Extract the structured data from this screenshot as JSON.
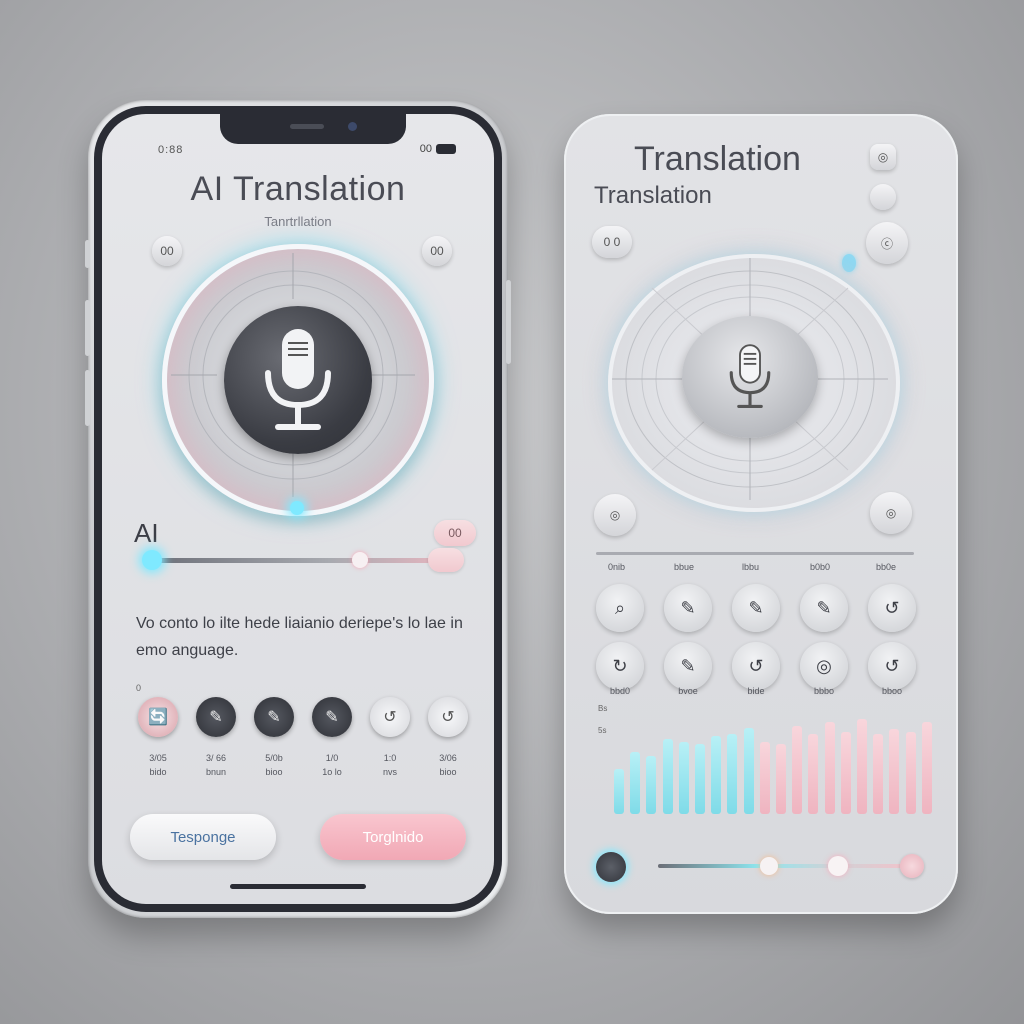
{
  "phone": {
    "status_left": "0:88",
    "status_right": "00",
    "title": "AI Translation",
    "subtitle": "Tanrtrllation",
    "top_left_button": "00",
    "top_right_button": "00",
    "ai_label": "AI",
    "ai_pill": "00",
    "body_text": "Vo conto lo ilte hede liaianio deriepe's lo lae in emo anguage.",
    "dot_marker": "0",
    "languages": [
      {
        "icon": "🔄",
        "caption1": "3/05",
        "caption2": "bido"
      },
      {
        "icon": "✎",
        "caption1": "3/ 66",
        "caption2": "bnun"
      },
      {
        "icon": "✎",
        "caption1": "5/0b",
        "caption2": "bioo"
      },
      {
        "icon": "✎",
        "caption1": "1/0",
        "caption2": "1o lo"
      },
      {
        "icon": "↺",
        "caption1": "1:0",
        "caption2": "nvs"
      },
      {
        "icon": "↺",
        "caption1": "3/06",
        "caption2": "bioo"
      }
    ],
    "left_button_label": "Tesponge",
    "right_button_label": "Torglnido"
  },
  "card": {
    "title_large": "Translation",
    "title_small": "Translation",
    "top_right_icon": "◎",
    "left_button": "0 0",
    "right_button": "ⓒ",
    "mid_left_button": "◎",
    "mid_right_button": "◎",
    "grid_headers": [
      "0nib",
      "bbue",
      "lbbu",
      "b0b0",
      "bb0e"
    ],
    "grid_row1": [
      "⌕",
      "✎",
      "✎",
      "✎",
      "↺"
    ],
    "grid_row2": [
      "↻",
      "✎",
      "↺",
      "◎",
      "↺"
    ],
    "grid_captions": [
      "bbd0",
      "bvoe",
      "bide",
      "bbbo",
      "bboo"
    ],
    "eq_labels": [
      "Bs",
      "5s"
    ],
    "eq_values": [
      0.45,
      0.62,
      0.58,
      0.75,
      0.72,
      0.7,
      0.78,
      0.8,
      0.86,
      0.72,
      0.7,
      0.88,
      0.8,
      0.92,
      0.82,
      0.95,
      0.8,
      0.85,
      0.82,
      0.92
    ]
  },
  "colors": {
    "accent_cyan": "#7fe9ff",
    "accent_pink": "#f4b7c3",
    "dark_core": "#3a3c43"
  }
}
